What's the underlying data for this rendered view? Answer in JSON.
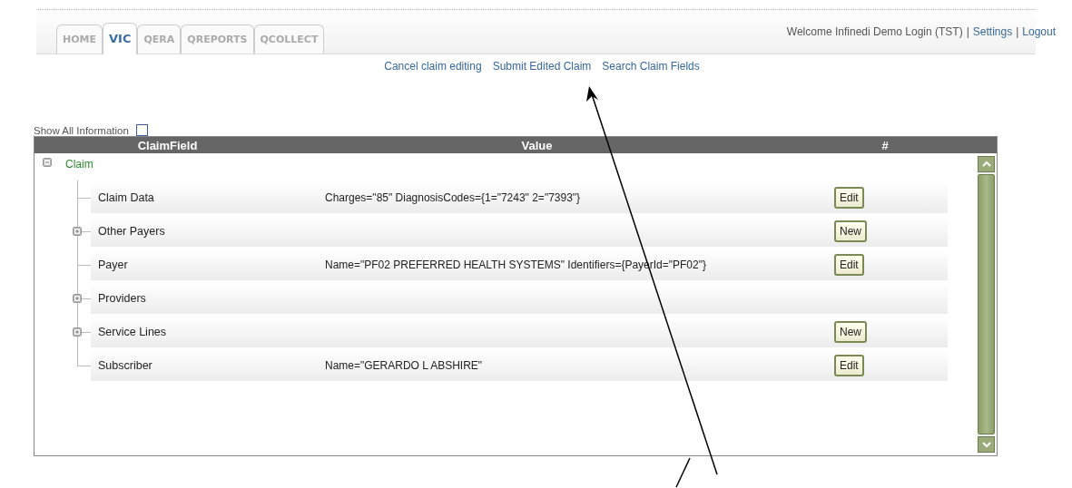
{
  "tabs": [
    {
      "label": "HOME",
      "selected": false
    },
    {
      "label": "VIC",
      "selected": true
    },
    {
      "label": "QERA",
      "selected": false
    },
    {
      "label": "QREPORTS",
      "selected": false
    },
    {
      "label": "QCOLLECT",
      "selected": false
    }
  ],
  "user_nav": {
    "welcome": "Welcome Infinedi Demo Login (TST)",
    "links": [
      {
        "separator": "|",
        "label": "Settings"
      },
      {
        "separator": "|",
        "label": "Logout"
      }
    ]
  },
  "actions": [
    "Cancel claim editing",
    "Submit Edited Claim",
    "Search Claim Fields"
  ],
  "show_all": {
    "label": "Show All Information",
    "checked": false
  },
  "table": {
    "columns": [
      "ClaimField",
      "Value",
      "#"
    ],
    "tree": [
      {
        "label": "Claim",
        "expanded": true,
        "children": [
          {
            "label": "Claim Data",
            "kind": "field",
            "value": "Charges=\"85\" DiagnosisCodes={1=\"7243\" 2=\"7393\"}",
            "action": "Edit"
          },
          {
            "label": "Other Payers",
            "kind": "group",
            "expanded": false,
            "action": "New"
          },
          {
            "label": "Payer",
            "kind": "field",
            "value": "Name=\"PF02 PREFERRED HEALTH SYSTEMS\" Identifiers={PayerId=\"PF02\"}",
            "action": "Edit"
          },
          {
            "label": "Providers",
            "kind": "group",
            "expanded": false
          },
          {
            "label": "Service Lines",
            "kind": "group",
            "expanded": false,
            "action": "New"
          },
          {
            "label": "Subscriber",
            "kind": "field",
            "value": "Name=\"GERARDO L ABSHIRE\"",
            "action": "Edit"
          }
        ]
      }
    ]
  }
}
